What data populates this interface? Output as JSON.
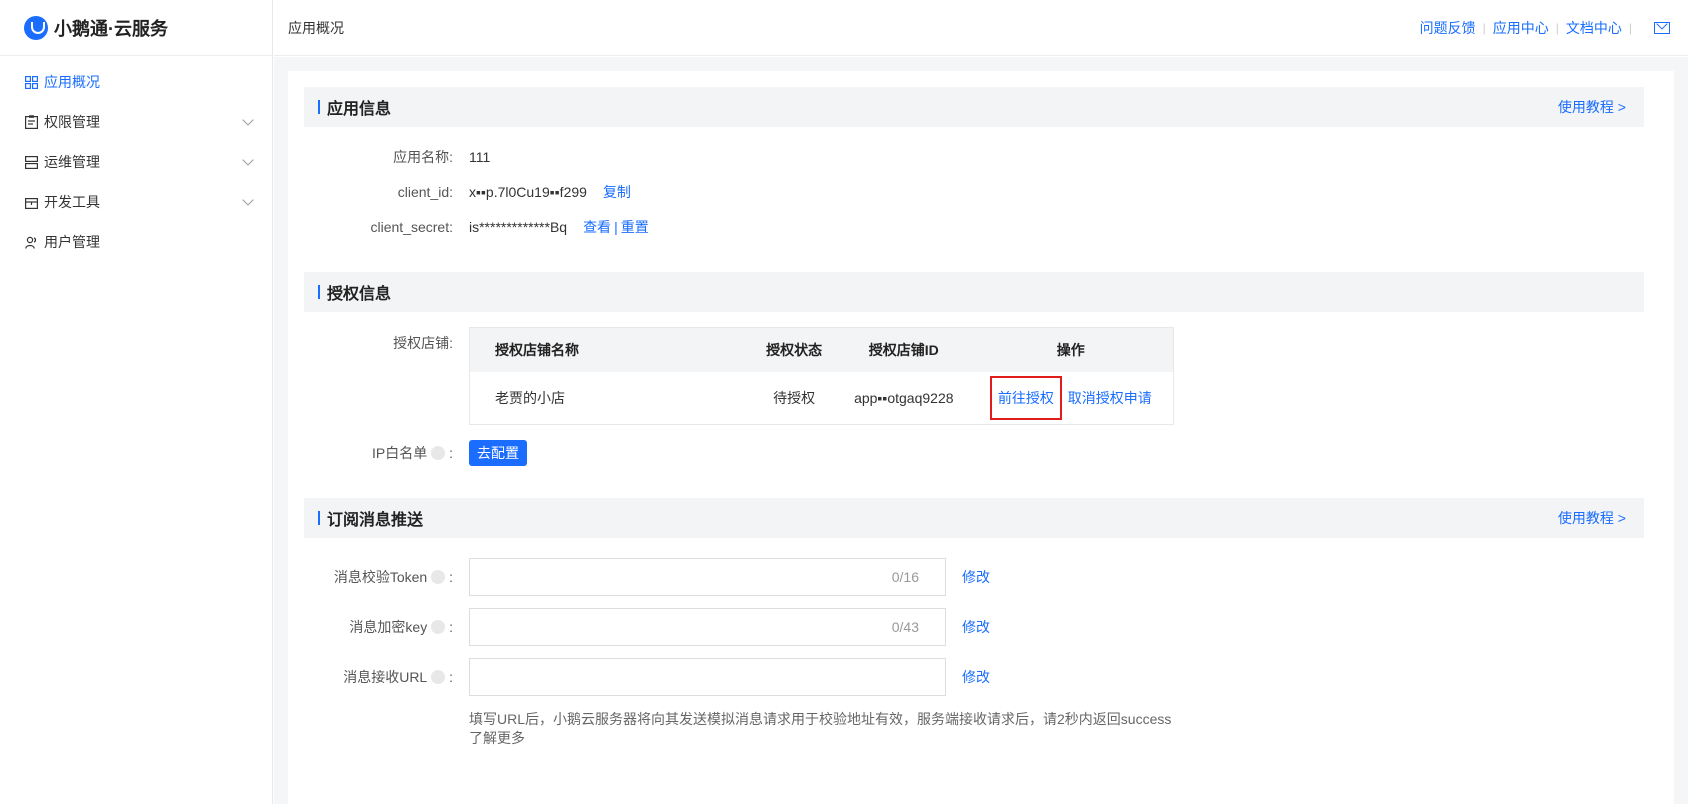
{
  "brand": {
    "name": "小鹅通·云服务"
  },
  "sidebar": {
    "items": [
      {
        "label": "应用概况",
        "icon": "grid-icon",
        "active": true,
        "expandable": false
      },
      {
        "label": "权限管理",
        "icon": "clipboard-icon",
        "active": false,
        "expandable": true
      },
      {
        "label": "运维管理",
        "icon": "server-icon",
        "active": false,
        "expandable": true
      },
      {
        "label": "开发工具",
        "icon": "toolbox-icon",
        "active": false,
        "expandable": true
      },
      {
        "label": "用户管理",
        "icon": "users-icon",
        "active": false,
        "expandable": false
      }
    ]
  },
  "topbar": {
    "title": "应用概况",
    "links": [
      "问题反馈",
      "应用中心",
      "文档中心"
    ],
    "mail_icon": "mail-icon"
  },
  "app_info": {
    "title": "应用信息",
    "tutorial_link": "使用教程 >",
    "name_label": "应用名称:",
    "name_value": "111",
    "client_id_label": "client_id:",
    "client_id_value": "x▪▪p.7l0Cu19▪▪f299",
    "copy_label": "复制",
    "client_secret_label": "client_secret:",
    "client_secret_value": "is*************Bq",
    "view_label": "查看",
    "divider": "|",
    "reset_label": "重置"
  },
  "auth_info": {
    "title": "授权信息",
    "shop_label": "授权店铺:",
    "headers": [
      "授权店铺名称",
      "授权状态",
      "授权店铺ID",
      "操作"
    ],
    "rows": [
      {
        "shop_name": "老贾的小店",
        "status": "待授权",
        "shop_id": "app▪▪otgaq9228",
        "action_primary": "前往授权",
        "action_secondary": "取消授权申请"
      }
    ],
    "ip_label": "IP白名单",
    "ip_colon": ":",
    "ip_button": "去配置"
  },
  "subscription": {
    "title": "订阅消息推送",
    "tutorial_link": "使用教程 >",
    "token_label": "消息校验Token",
    "token_counter": "0/16",
    "key_label": "消息加密key",
    "key_counter": "0/43",
    "url_label": "消息接收URL",
    "colon": ":",
    "modify_label": "修改",
    "hint": "填写URL后，小鹅云服务器将向其发送模拟消息请求用于校验地址有效，服务端接收请求后，请2秒内返回success",
    "learn_more": "了解更多"
  },
  "colors": {
    "accent": "#1a6dff",
    "highlight_border": "#e21b1b"
  }
}
